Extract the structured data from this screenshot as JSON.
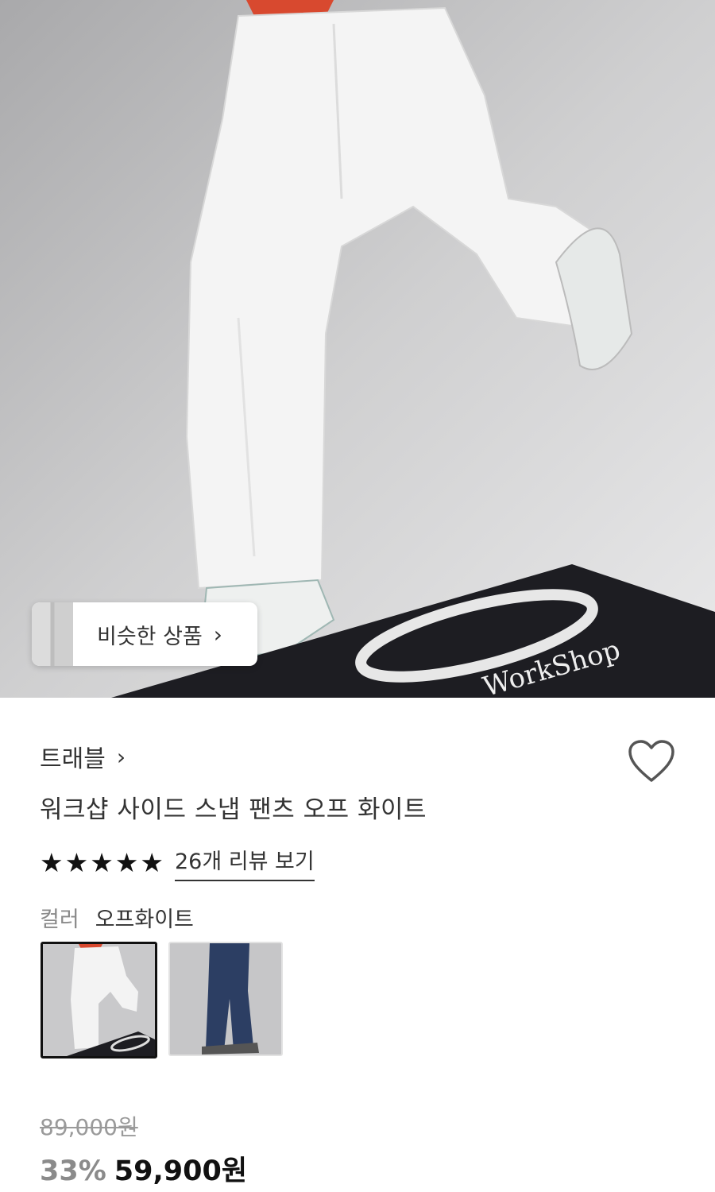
{
  "hero": {
    "board_logo_text": "WorkShop"
  },
  "similar_products": {
    "label": "비슷한 상품",
    "icon": "chevron-right-icon"
  },
  "product": {
    "brand": "트래블",
    "name": "워크샵 사이드 스냅 팬츠 오프 화이트",
    "rating_stars": 5,
    "review_link": "26개 리뷰 보기",
    "color_label": "컬러",
    "color_value": "오프화이트",
    "swatches": [
      {
        "name": "오프화이트",
        "selected": true
      },
      {
        "name": "denim",
        "selected": false
      }
    ],
    "original_price": "89,000원",
    "discount": "33%",
    "sale_price": "59,900원"
  },
  "colors": {
    "text_primary": "#222222",
    "text_muted": "#8a8a8a"
  }
}
